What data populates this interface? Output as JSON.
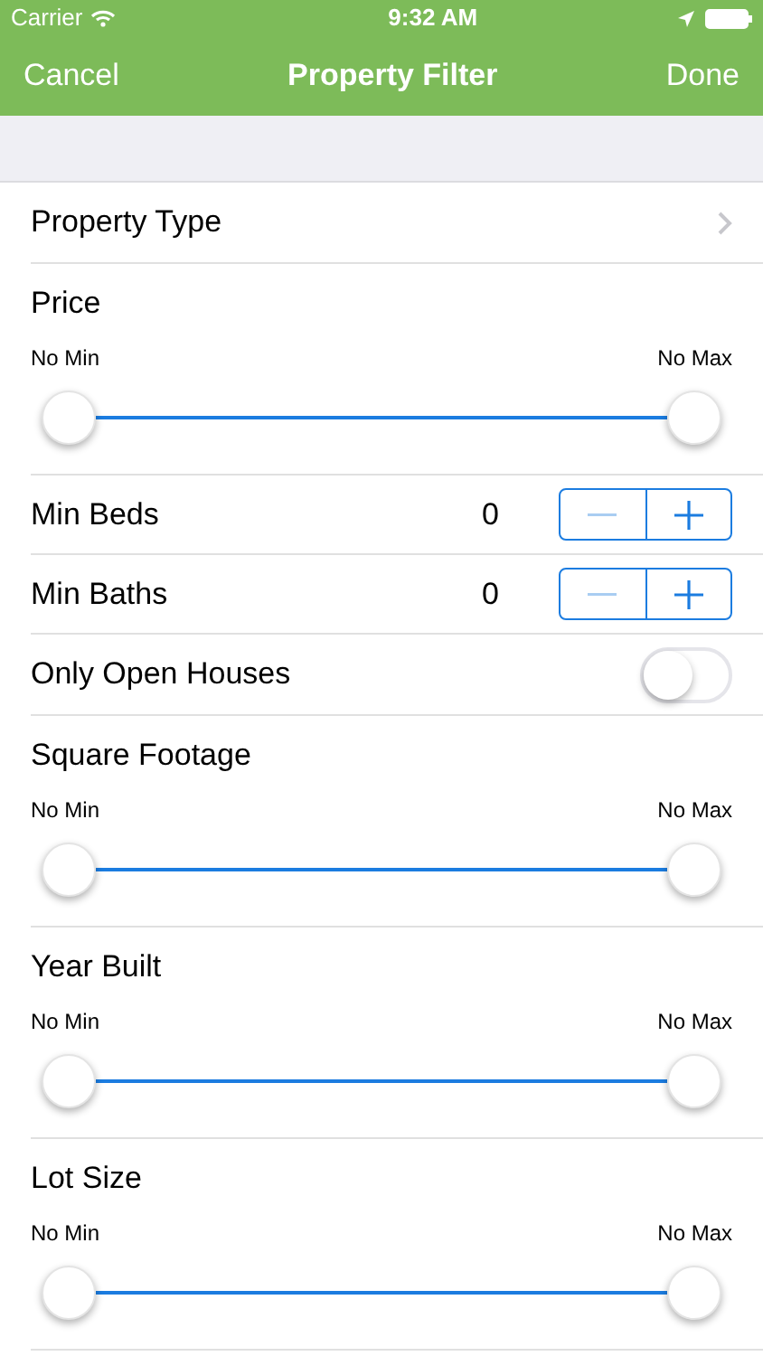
{
  "status_bar": {
    "carrier": "Carrier",
    "time": "9:32 AM"
  },
  "nav_bar": {
    "left_button": "Cancel",
    "title": "Property Filter",
    "right_button": "Done"
  },
  "rows": [
    {
      "kind": "disclosure",
      "label": "Property Type"
    },
    {
      "kind": "range",
      "label": "Price",
      "min_label": "No Min",
      "max_label": "No Max",
      "thumbs": [
        {
          "level": 0
        },
        {
          "level": 1
        }
      ]
    },
    {
      "kind": "stepper",
      "label": "Min Beds",
      "value": "0",
      "minus_disabled": true
    },
    {
      "kind": "stepper",
      "label": "Min Baths",
      "value": "0",
      "minus_disabled": true
    },
    {
      "kind": "toggle",
      "label": "Only Open Houses",
      "on": false
    },
    {
      "kind": "range",
      "label": "Square Footage",
      "min_label": "No Min",
      "max_label": "No Max",
      "thumbs": [
        {
          "level": 0
        },
        {
          "level": 1
        }
      ]
    },
    {
      "kind": "range",
      "label": "Year Built",
      "min_label": "No Min",
      "max_label": "No Max",
      "thumbs": [
        {
          "level": 0
        },
        {
          "level": 1
        }
      ]
    },
    {
      "kind": "range",
      "label": "Lot Size",
      "min_label": "No Min",
      "max_label": "No Max",
      "thumbs": [
        {
          "level": 0
        },
        {
          "level": 1
        }
      ]
    }
  ]
}
